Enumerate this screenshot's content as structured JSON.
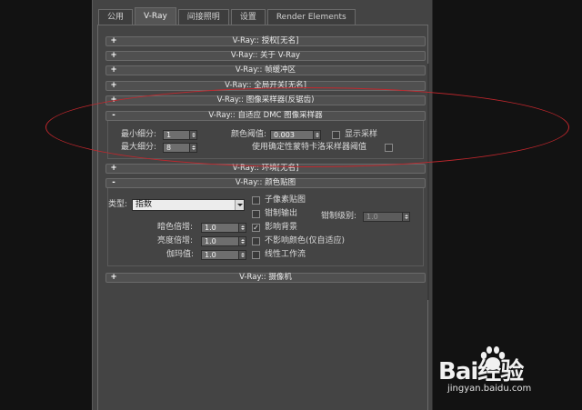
{
  "tabs": [
    {
      "label": "公用",
      "active": false
    },
    {
      "label": "V-Ray",
      "active": true
    },
    {
      "label": "间接照明",
      "active": false
    },
    {
      "label": "设置",
      "active": false
    },
    {
      "label": "Render Elements",
      "active": false
    }
  ],
  "rollouts": {
    "authorization": {
      "sign": "+",
      "label": "V-Ray:: 授权[无名]"
    },
    "about": {
      "sign": "+",
      "label": "V-Ray:: 关于 V-Ray"
    },
    "frame_buffer": {
      "sign": "+",
      "label": "V-Ray:: 帧缓冲区"
    },
    "global_switches": {
      "sign": "+",
      "label": "V-Ray:: 全局开关[无名]"
    },
    "image_sampler": {
      "sign": "+",
      "label": "V-Ray:: 图像采样器(反锯齿)"
    },
    "adaptive_dmc": {
      "sign": "-",
      "label": "V-Ray:: 自适应 DMC 图像采样器"
    },
    "environment": {
      "sign": "+",
      "label": "V-Ray:: 环境[无名]"
    },
    "color_mapping": {
      "sign": "-",
      "label": "V-Ray:: 颜色贴图"
    },
    "camera": {
      "sign": "+",
      "label": "V-Ray:: 摄像机"
    }
  },
  "adaptive_dmc": {
    "min_subdivs_label": "最小细分:",
    "min_subdivs_value": "1",
    "max_subdivs_label": "最大细分:",
    "max_subdivs_value": "8",
    "color_threshold_label": "颜色阈值:",
    "color_threshold_value": "0.003",
    "show_samples_label": "显示采样",
    "use_dmc_threshold_label": "使用确定性蒙特卡洛采样器阈值"
  },
  "color_mapping": {
    "type_label": "类型:",
    "type_value": "指数",
    "subpixel_label": "子像素贴图",
    "clamp_output_label": "钳制输出",
    "clamp_level_label": "钳制级别:",
    "clamp_level_value": "1.0",
    "affect_bg_label": "影响背景",
    "affect_bg_checked": "✓",
    "no_affect_colors_label": "不影响颜色(仅自适应)",
    "linear_workflow_label": "线性工作流",
    "dark_mult_label": "暗色倍增:",
    "dark_mult_value": "1.0",
    "bright_mult_label": "亮度倍增:",
    "bright_mult_value": "1.0",
    "gamma_label": "伽玛值:",
    "gamma_value": "1.0"
  },
  "watermark": {
    "logo": "Bai经验",
    "url": "jingyan.baidu.com"
  },
  "colors": {
    "annotation": "#c1272d",
    "panel": "#444444"
  }
}
